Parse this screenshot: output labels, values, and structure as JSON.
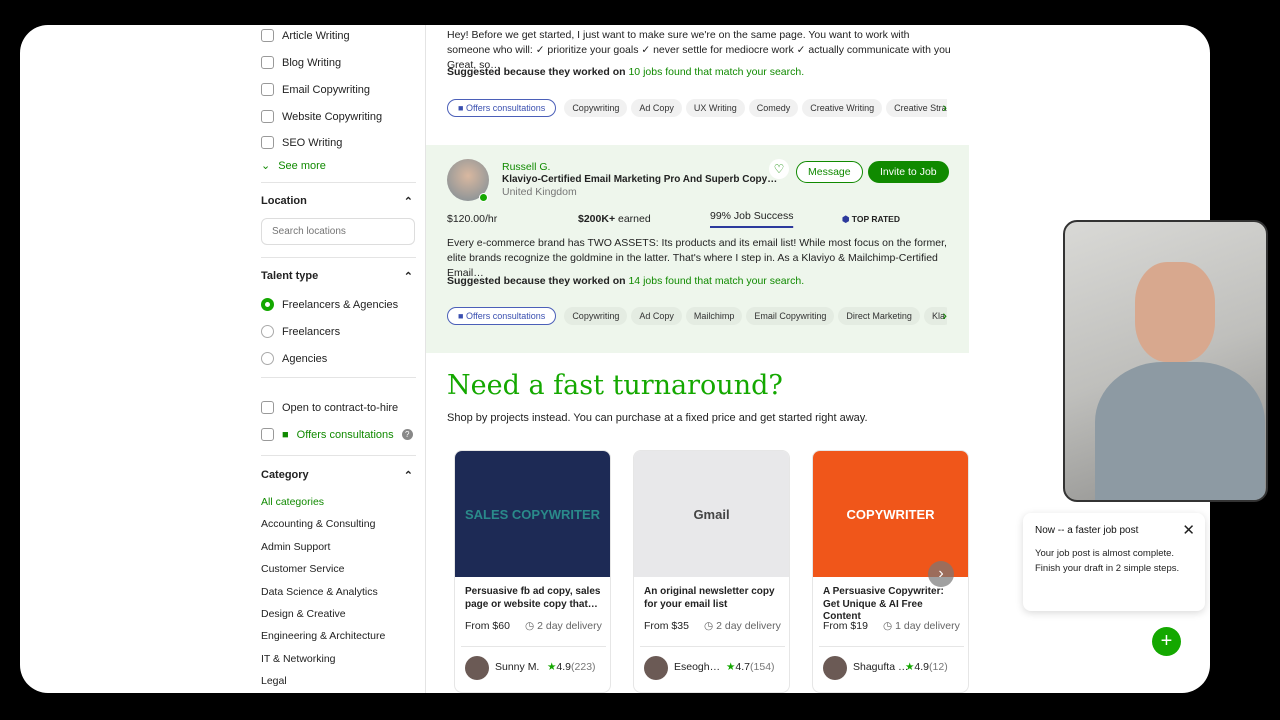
{
  "sidebar": {
    "skills": [
      "Article Writing",
      "Blog Writing",
      "Email Copywriting",
      "Website Copywriting",
      "SEO Writing"
    ],
    "see_more": "See more",
    "location": {
      "title": "Location",
      "placeholder": "Search locations"
    },
    "talent": {
      "title": "Talent type",
      "options": [
        "Freelancers & Agencies",
        "Freelancers",
        "Agencies"
      ],
      "selected": "Freelancers & Agencies"
    },
    "contract_to_hire": "Open to contract-to-hire",
    "offers_consultations": "Offers consultations",
    "category": {
      "title": "Category",
      "items": [
        "All categories",
        "Accounting & Consulting",
        "Admin Support",
        "Customer Service",
        "Data Science & Analytics",
        "Design & Creative",
        "Engineering & Architecture",
        "IT & Networking",
        "Legal"
      ]
    }
  },
  "card1": {
    "desc": "Hey! Before we get started, I just want to make sure we're on the same page. You want to work with someone who will: ✓ prioritize your goals ✓ never settle for mediocre work ✓ actually communicate with you Great, so…",
    "suggested": "Suggested because they worked on ",
    "suggested_link": "10 jobs found that match your search.",
    "consult": "Offers consultations",
    "skills": [
      "Copywriting",
      "Ad Copy",
      "UX Writing",
      "Comedy",
      "Creative Writing",
      "Creative Stra"
    ]
  },
  "card2": {
    "name": "Russell G.",
    "title": "Klaviyo-Certified Email Marketing Pro And Superb Copy…",
    "country": "United Kingdom",
    "message": "Message",
    "invite": "Invite to Job",
    "rate": "$120.00/hr",
    "earned": "$200K+",
    "earned_label": " earned",
    "job_success": "99% Job Success",
    "job_success_pct": 99,
    "badge": "TOP RATED",
    "desc": "Every e-commerce brand has TWO ASSETS: Its products and its email list! While most focus on the former, elite brands recognize the goldmine in the latter. That's where I step in. As a Klaviyo & Mailchimp-Certified Email…",
    "suggested": "Suggested because they worked on ",
    "suggested_link": "14 jobs found that match your search.",
    "consult": "Offers consultations",
    "skills": [
      "Copywriting",
      "Ad Copy",
      "Mailchimp",
      "Email Copywriting",
      "Direct Marketing",
      "Kla"
    ]
  },
  "projects": {
    "title": "Need a fast turnaround?",
    "subtitle": "Shop by projects instead. You can purchase at a fixed price and get started right away.",
    "items": [
      {
        "img_text": "SALES COPYWRITER",
        "title": "Persuasive fb ad copy, sales page or website copy that…",
        "price": "From $60",
        "delivery": "2 day delivery",
        "seller": "Sunny M.",
        "rating": "4.9",
        "count": "(223)",
        "color": "#1d2a55"
      },
      {
        "img_text": "Gmail",
        "title": "An original newsletter copy for your email list",
        "price": "From $35",
        "delivery": "2 day delivery",
        "seller": "Eseogh…",
        "rating": "4.7",
        "count": "(154)",
        "color": "#e8e8ea"
      },
      {
        "img_text": "COPYWRITER",
        "title": "A Persuasive Copywriter: Get Unique & AI Free Content",
        "price": "From $19",
        "delivery": "1 day delivery",
        "seller": "Shagufta …",
        "rating": "4.9",
        "count": "(12)",
        "color": "#f0561a"
      }
    ]
  },
  "popup": {
    "title": "Now -- a faster job post",
    "body": "Your job post is almost complete. Finish your draft in 2 simple steps."
  },
  "colors": {
    "brand": "#14a800",
    "link": "#108a00"
  }
}
